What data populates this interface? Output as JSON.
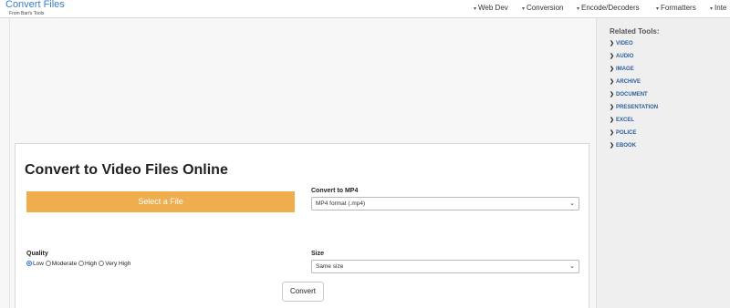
{
  "brand": {
    "title": "Convert Files",
    "subtitle": "From Bari's Tools"
  },
  "nav": [
    {
      "label": "Web Dev"
    },
    {
      "label": "Conversion"
    },
    {
      "label": "Encode/Decoders"
    },
    {
      "label": "Formatters"
    },
    {
      "label": "Inte"
    }
  ],
  "card": {
    "title": "Convert to Video Files Online",
    "select_file_label": "Select a File",
    "convert_to_label": "Convert to MP4",
    "format_value": "MP4 format (.mp4)",
    "quality_label": "Quality",
    "quality_options": [
      "Low",
      "Moderate",
      "High",
      "Very High"
    ],
    "quality_selected": "Low",
    "size_label": "Size",
    "size_value": "Same size",
    "convert_button": "Convert"
  },
  "sidebar": {
    "title": "Related Tools:",
    "items": [
      "VIDEO",
      "AUDIO",
      "IMAGE",
      "ARCHIVE",
      "DOCUMENT",
      "PRESENTATION",
      "EXCEL",
      "POLICE",
      "EBOOK"
    ]
  },
  "colors": {
    "accent": "#efad4d",
    "link": "#2c5f9e",
    "brand": "#3b7dc4"
  }
}
